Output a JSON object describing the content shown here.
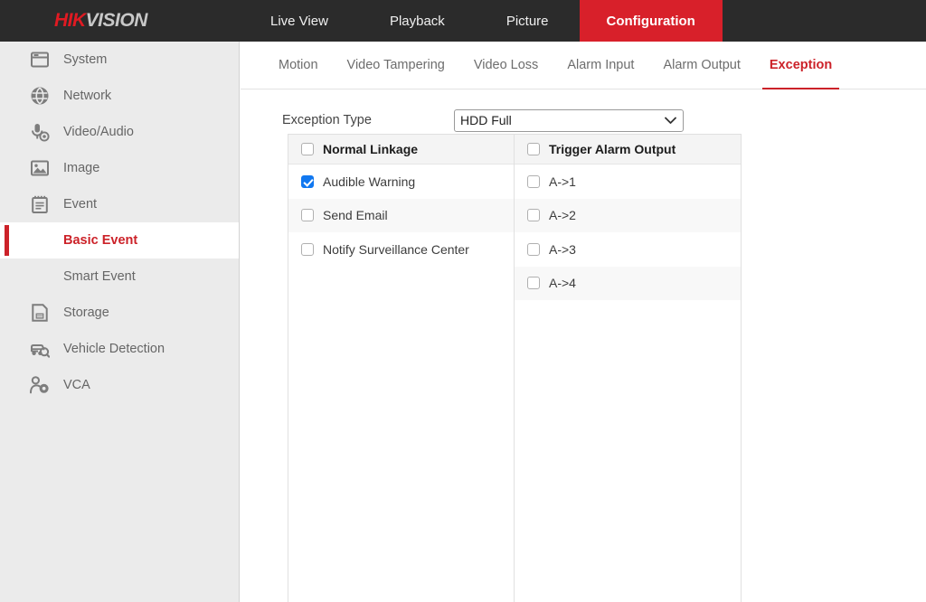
{
  "brand": {
    "part1": "HIK",
    "part2": "VISION"
  },
  "topnav": {
    "items": [
      {
        "label": "Live View",
        "active": false
      },
      {
        "label": "Playback",
        "active": false
      },
      {
        "label": "Picture",
        "active": false
      },
      {
        "label": "Configuration",
        "active": true
      }
    ],
    "accent_color": "#d8202a"
  },
  "sidebar": {
    "items": [
      {
        "label": "System",
        "icon": "system-window-icon",
        "sub": false,
        "active": false
      },
      {
        "label": "Network",
        "icon": "globe-icon",
        "sub": false,
        "active": false
      },
      {
        "label": "Video/Audio",
        "icon": "microphone-icon",
        "sub": false,
        "active": false
      },
      {
        "label": "Image",
        "icon": "picture-icon",
        "sub": false,
        "active": false
      },
      {
        "label": "Event",
        "icon": "notepad-icon",
        "sub": false,
        "active": false
      },
      {
        "label": "Basic Event",
        "icon": "none",
        "sub": true,
        "active": true
      },
      {
        "label": "Smart Event",
        "icon": "none",
        "sub": true,
        "active": false
      },
      {
        "label": "Storage",
        "icon": "floppy-disk-icon",
        "sub": false,
        "active": false
      },
      {
        "label": "Vehicle Detection",
        "icon": "car-search-icon",
        "sub": false,
        "active": false
      },
      {
        "label": "VCA",
        "icon": "person-gear-icon",
        "sub": false,
        "active": false
      }
    ],
    "active_color": "#cc2229"
  },
  "tabs": {
    "items": [
      {
        "label": "Motion",
        "active": false
      },
      {
        "label": "Video Tampering",
        "active": false
      },
      {
        "label": "Video Loss",
        "active": false
      },
      {
        "label": "Alarm Input",
        "active": false
      },
      {
        "label": "Alarm Output",
        "active": false
      },
      {
        "label": "Exception",
        "active": true
      }
    ]
  },
  "form": {
    "exception_type_label": "Exception Type",
    "exception_type_value": "HDD Full",
    "exception_type_options": [
      "HDD Full"
    ]
  },
  "linkage": {
    "left": {
      "header": "Normal Linkage",
      "header_checked": false,
      "rows": [
        {
          "label": "Audible Warning",
          "checked": true
        },
        {
          "label": "Send Email",
          "checked": false
        },
        {
          "label": "Notify Surveillance Center",
          "checked": false
        }
      ]
    },
    "right": {
      "header": "Trigger Alarm Output",
      "header_checked": false,
      "rows": [
        {
          "label": "A->1",
          "checked": false
        },
        {
          "label": "A->2",
          "checked": false
        },
        {
          "label": "A->3",
          "checked": false
        },
        {
          "label": "A->4",
          "checked": false
        }
      ]
    },
    "checked_color": "#1178f0"
  }
}
